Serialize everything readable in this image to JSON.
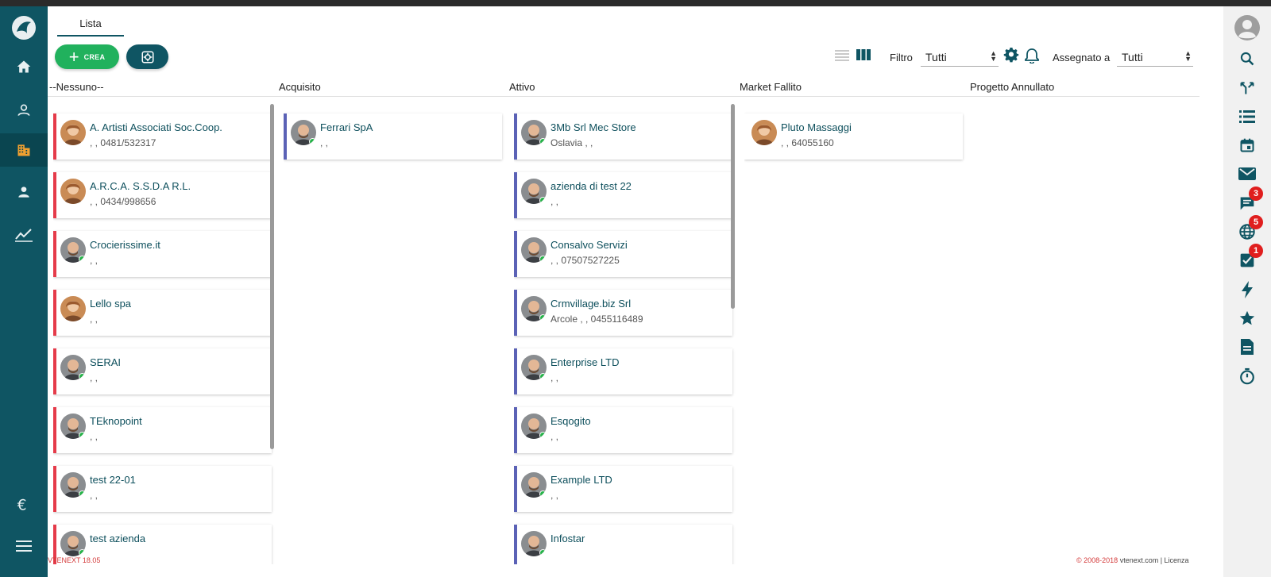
{
  "tab": {
    "label": "Lista"
  },
  "toolbar": {
    "create_label": "CREA",
    "filter_label": "Filtro",
    "filter_value": "Tutti",
    "assigned_label": "Assegnato a",
    "assigned_value": "Tutti"
  },
  "columns": [
    {
      "title": "--Nessuno--",
      "cards": [
        {
          "name": "A. Artisti Associati Soc.Coop.",
          "sub": ", , 0481/532317",
          "avatar": "woman"
        },
        {
          "name": "A.R.C.A. S.S.D.A R.L.",
          "sub": ", , 0434/998656",
          "avatar": "woman"
        },
        {
          "name": "Crocierissime.it",
          "sub": ", ,",
          "avatar": "man"
        },
        {
          "name": "Lello spa",
          "sub": ", ,",
          "avatar": "woman"
        },
        {
          "name": "SERAI",
          "sub": ", ,",
          "avatar": "man"
        },
        {
          "name": "TEknopoint",
          "sub": ", ,",
          "avatar": "man"
        },
        {
          "name": "test 22-01",
          "sub": ", ,",
          "avatar": "man"
        },
        {
          "name": "test azienda",
          "sub": "",
          "avatar": "man"
        }
      ]
    },
    {
      "title": "Acquisito",
      "cards": [
        {
          "name": "Ferrari SpA",
          "sub": ", ,",
          "avatar": "man"
        }
      ]
    },
    {
      "title": "Attivo",
      "cards": [
        {
          "name": "3Mb Srl Mec Store",
          "sub": "Oslavia , ,",
          "avatar": "man"
        },
        {
          "name": "azienda di test 22",
          "sub": ", ,",
          "avatar": "man"
        },
        {
          "name": "Consalvo Servizi",
          "sub": ", , 07507527225",
          "avatar": "man"
        },
        {
          "name": "Crmvillage.biz Srl",
          "sub": "Arcole , , 0455116489",
          "avatar": "man"
        },
        {
          "name": "Enterprise LTD",
          "sub": ", ,",
          "avatar": "man"
        },
        {
          "name": "Esqogito",
          "sub": ", ,",
          "avatar": "man"
        },
        {
          "name": "Example LTD",
          "sub": ", ,",
          "avatar": "man"
        },
        {
          "name": "Infostar",
          "sub": "",
          "avatar": "man"
        }
      ]
    },
    {
      "title": "Market Fallito",
      "cards": [
        {
          "name": "Pluto Massaggi",
          "sub": ", , 64055160",
          "avatar": "woman"
        }
      ]
    },
    {
      "title": "Progetto Annullato",
      "cards": []
    }
  ],
  "badges": {
    "chat": "3",
    "globe": "5",
    "tasks": "1"
  },
  "footer": {
    "version": "VTENEXT 18.05",
    "copyright": "© 2008-2018",
    "links": "vtenext.com | Licenza"
  },
  "colors": {
    "sidebar": "#0f5563",
    "create": "#21b15d",
    "red_border": "#e53b4a",
    "blue_border": "#5b62b6"
  },
  "icons": {
    "left": [
      "logo-icon",
      "home-icon",
      "user-outline-icon",
      "building-icon",
      "person-icon",
      "chart-line-icon",
      "euro-icon",
      "menu-icon"
    ],
    "right": [
      "avatar-icon",
      "search-icon",
      "merge-icon",
      "list-icon",
      "calendar-icon",
      "mail-icon",
      "chat-icon",
      "globe-icon",
      "task-check-icon",
      "bolt-icon",
      "star-icon",
      "document-icon",
      "timer-icon"
    ]
  }
}
